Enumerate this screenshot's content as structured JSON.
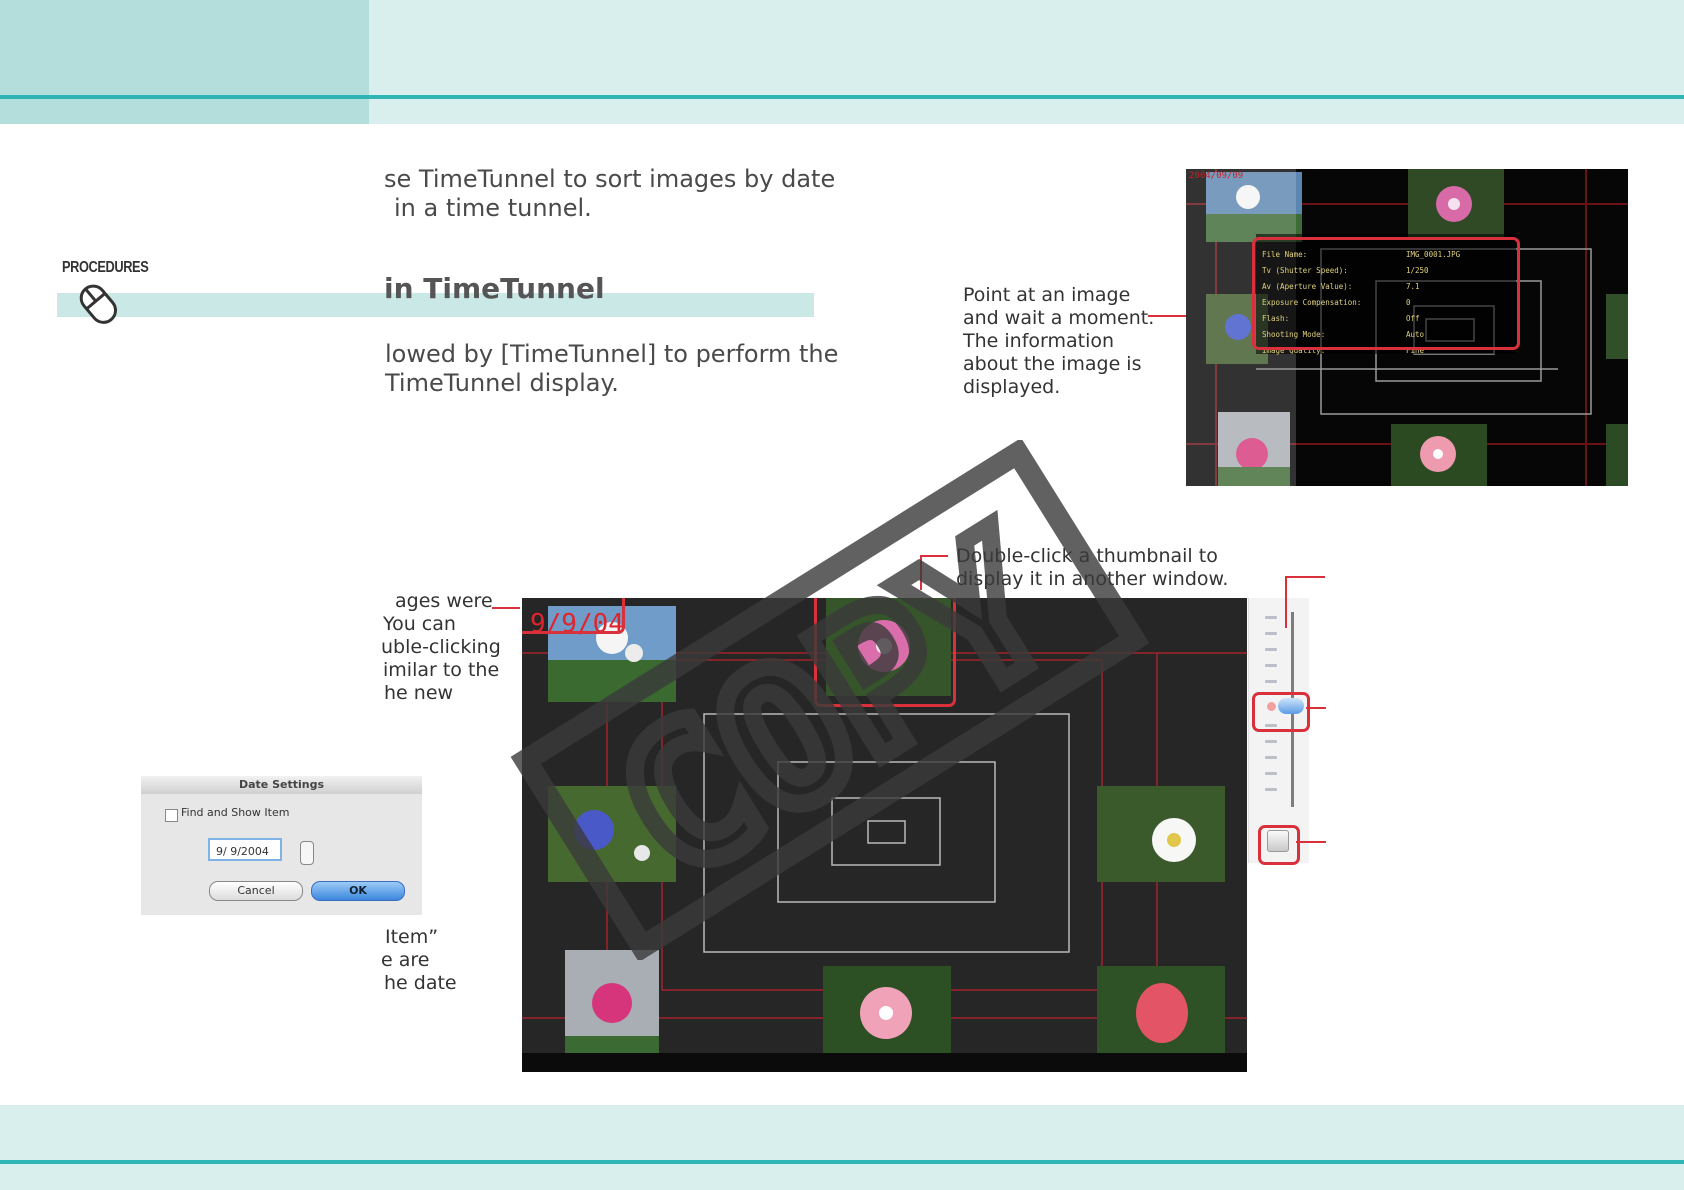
{
  "intro": {
    "line1": "se TimeTunnel to sort images by date",
    "line2": "in a time tunnel."
  },
  "procedures": {
    "label": "PROCEDURES",
    "icon": "mouse-icon",
    "title": "in TimeTunnel",
    "step_line1": "lowed by [TimeTunnel] to perform the",
    "step_line2": "TimeTunnel display."
  },
  "callouts": {
    "point_at_image": [
      "Point at an image",
      "and wait a moment.",
      "The information",
      "about the image is",
      "displayed."
    ],
    "double_click": [
      "Double-click a thumbnail to",
      "display it in another window."
    ],
    "date_left": [
      "ages were",
      " You can",
      "uble-clicking",
      "imilar to the",
      "he new"
    ],
    "item": [
      "Item”",
      "e are",
      "he date"
    ]
  },
  "info_screenshot": {
    "corner_label": "2004/09/09",
    "rows": [
      {
        "label": "File Name:",
        "value": "IMG_0001.JPG"
      },
      {
        "label": "Tv (Shutter Speed):",
        "value": "1/250"
      },
      {
        "label": "Av (Aperture Value):",
        "value": "7.1"
      },
      {
        "label": "Exposure Compensation:",
        "value": "0"
      },
      {
        "label": "Flash:",
        "value": "Off"
      },
      {
        "label": "Shooting Mode:",
        "value": "Auto"
      },
      {
        "label": "Image Quality:",
        "value": "Fine"
      }
    ]
  },
  "main_screenshot": {
    "date_label": "9/9/04"
  },
  "date_dialog": {
    "title": "Date Settings",
    "checkbox_label": "Find and Show Item",
    "date_value": "9/ 9/2004",
    "cancel_label": "Cancel",
    "ok_label": "OK"
  },
  "watermark": "COPY",
  "colors": {
    "header_dark": "#b3dedb",
    "header_light": "#d9efed",
    "accent_line": "#2fb5b5",
    "highlight": "#d8313b",
    "date_red": "#e0242c"
  }
}
